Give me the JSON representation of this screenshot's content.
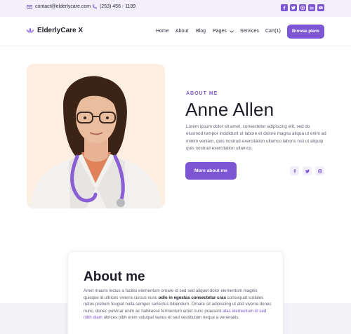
{
  "topbar": {
    "email": "contact@elderlycare.com",
    "phone": "(253) 456 - 1189",
    "social": [
      "facebook-icon",
      "twitter-icon",
      "instagram-icon",
      "linkedin-icon",
      "youtube-icon"
    ]
  },
  "nav": {
    "brand": "ElderlyCare X",
    "items": [
      "Home",
      "About",
      "Blog",
      "Pages",
      "Services",
      "Cart(1)"
    ],
    "cta": "Browse plans"
  },
  "hero": {
    "eyebrow": "ABOUT ME",
    "name": "Anne Allen",
    "lead": "Lorem ipsum dolor sit amet, consectetur adipiscing elit, sed do eiusmod tempor incididunt ut labore et dolore magna aliqua ut enim ad minim veniam, quis nostrud exercitation ullamco laboris nisi ut aliquip quis nostrud exercitation ullamco.",
    "cta": "More about me",
    "social": [
      "facebook-icon",
      "twitter-icon",
      "instagram-icon"
    ]
  },
  "about": {
    "title": "About me",
    "text_1": "Amet mauris lectus a facilisi elementum ornare id sed sed aliquet dolor elementum magnis quisque id ultrices viverra cursus nunc ",
    "text_bold": "odio in egestas consectetur cras",
    "text_2": " consequat sodales netus pretium feugiat nulla semper senectus bibendum. Ornare sit adipiscing ut atid viverra donec nunc, donec pulvinar enim ac habitasse fermentum amet nunc praesent ",
    "text_link": "atac elementum id sed nibh diam",
    "text_3": " ultrices nibh enim volutpat varius et sed vestibulum neque a venenatis."
  },
  "colors": {
    "accent": "#7d57d3",
    "topbar_bg": "#f3f0fb",
    "photo_bg": "#fdeee2"
  }
}
